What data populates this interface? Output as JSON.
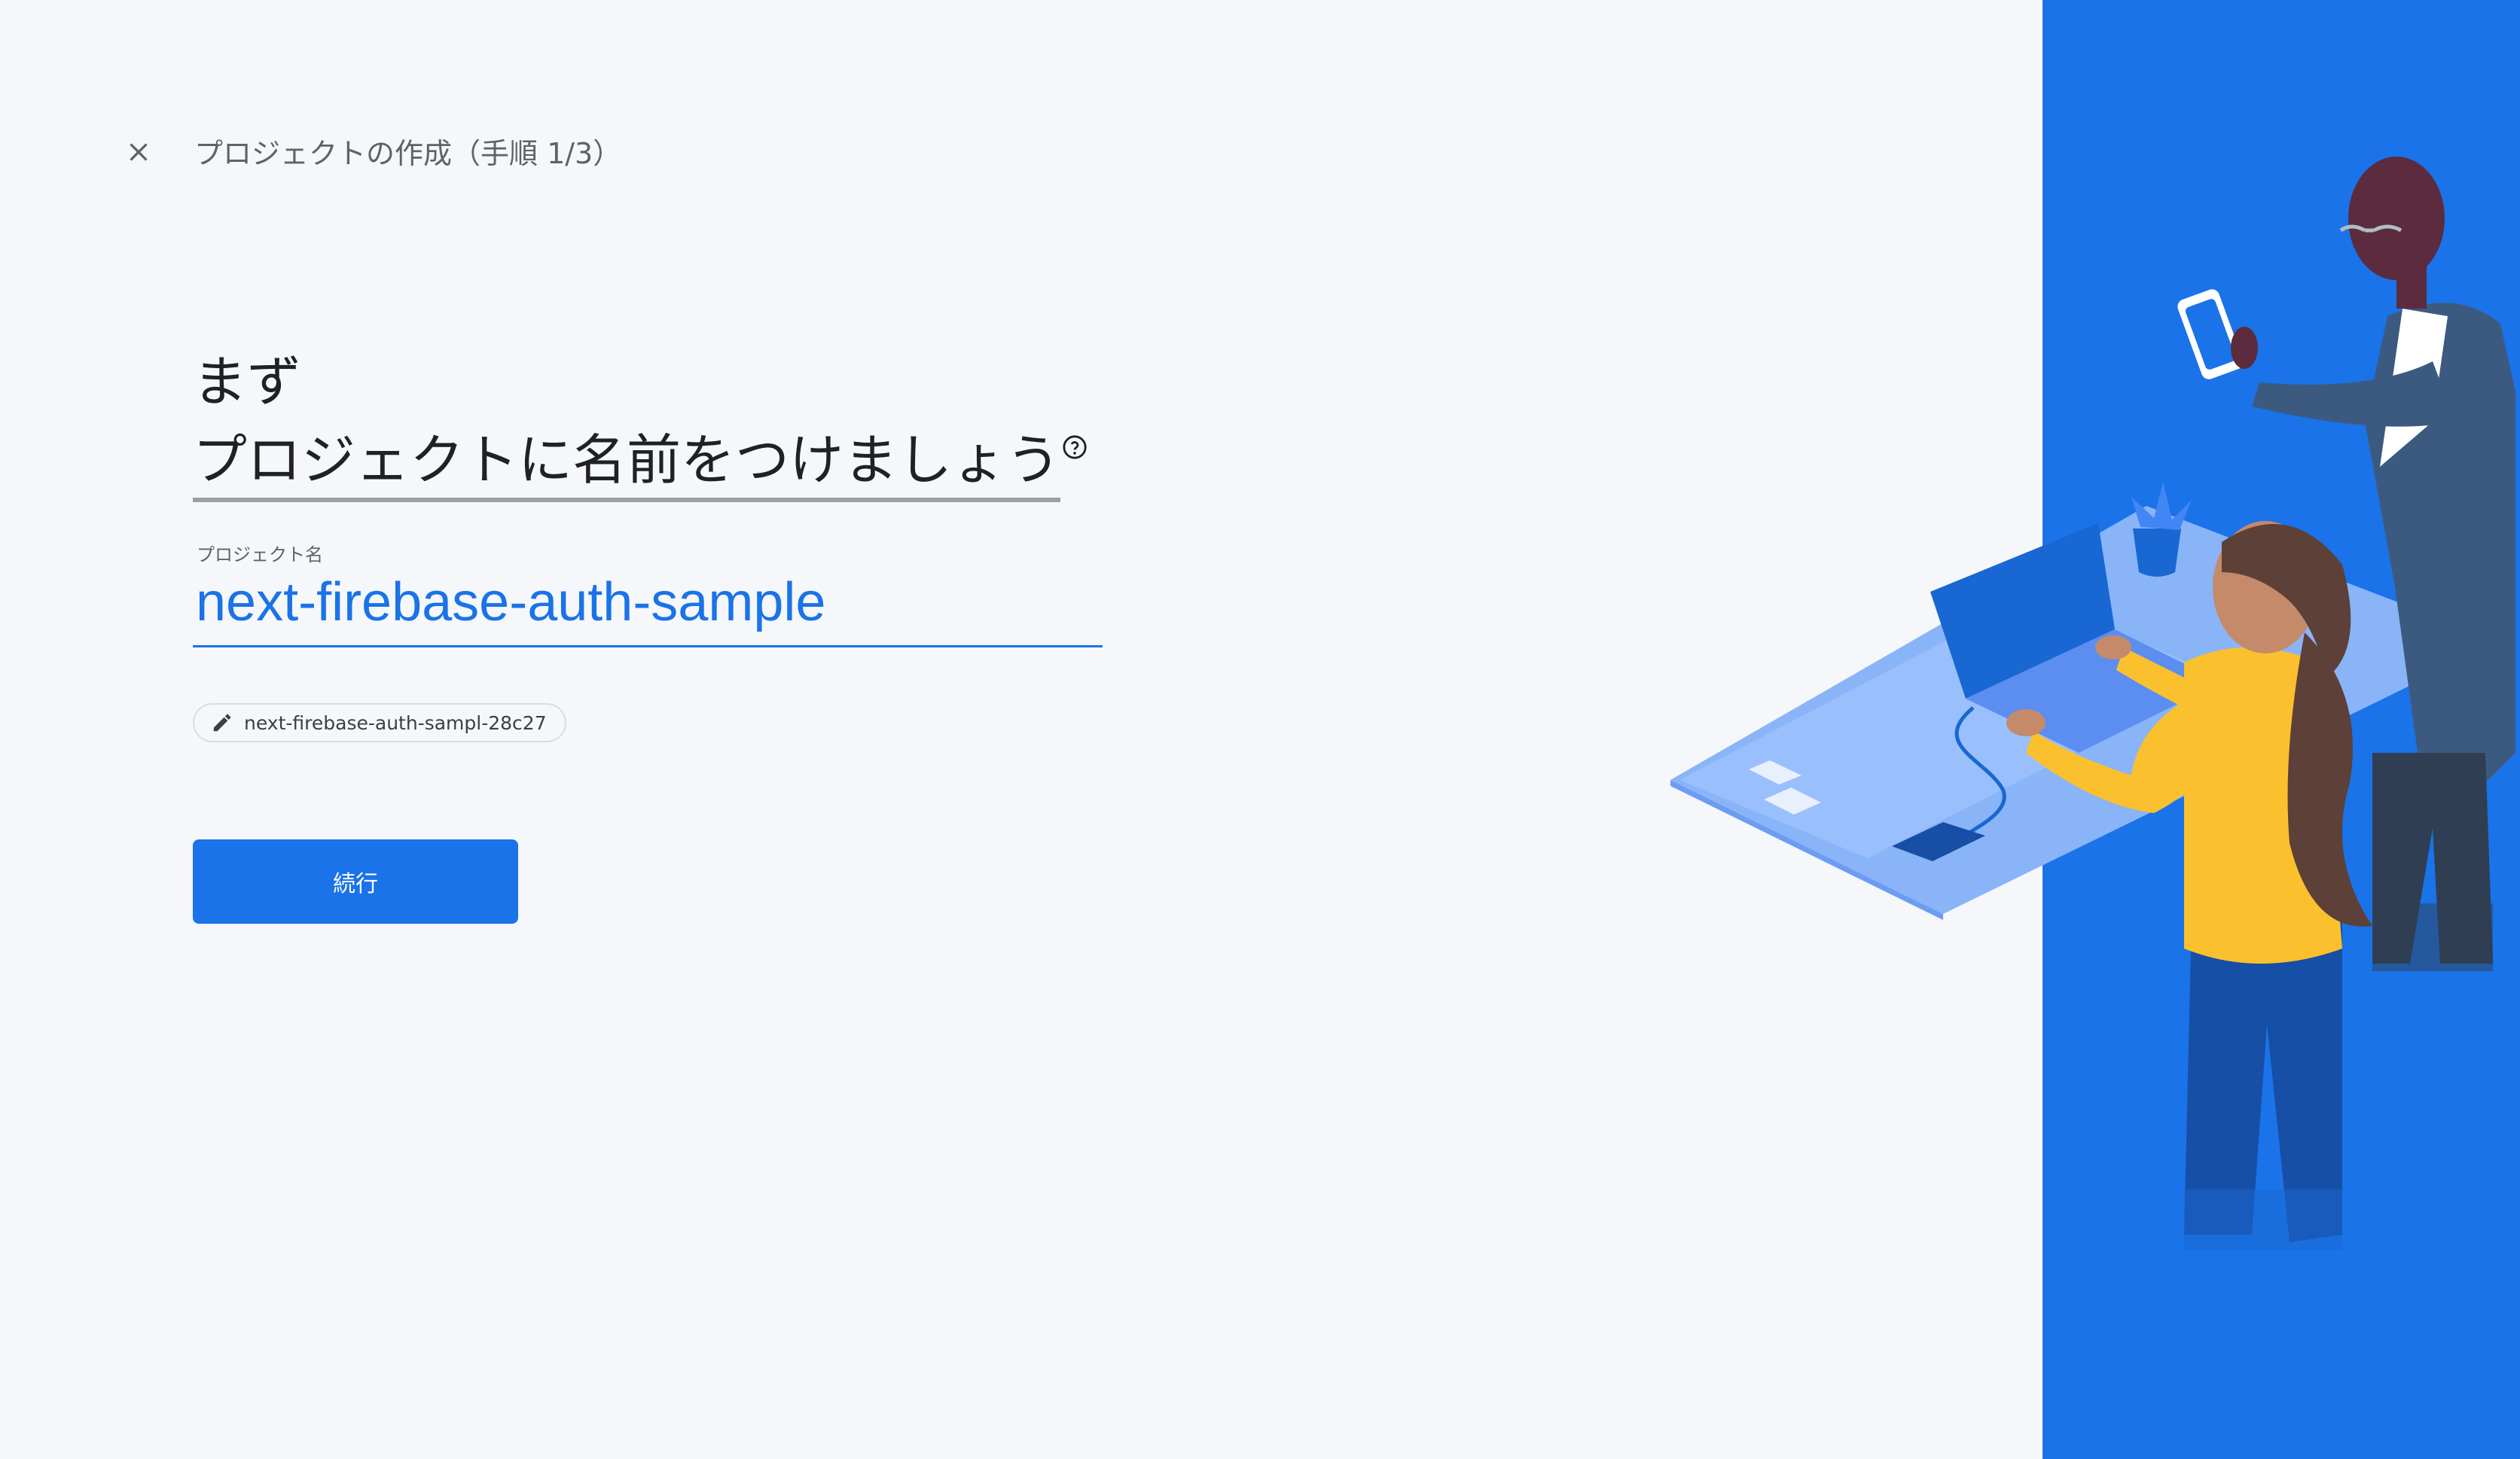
{
  "header": {
    "title": "プロジェクトの作成（手順 1/3）",
    "close_icon": "close-icon"
  },
  "main": {
    "heading_line1": "まず",
    "heading_line2": "プロジェクトに名前をつけましょう",
    "help_icon": "help-circle-icon",
    "field_label": "プロジェクト名",
    "project_name_value": "next-firebase-auth-sample",
    "project_id_chip": "next-firebase-auth-sampl-28c27",
    "edit_icon": "pencil-icon",
    "continue_label": "続行"
  },
  "colors": {
    "accent": "#1a73e8",
    "background": "#f5f7fa",
    "text_primary": "#202124",
    "text_secondary": "#5f6368"
  }
}
